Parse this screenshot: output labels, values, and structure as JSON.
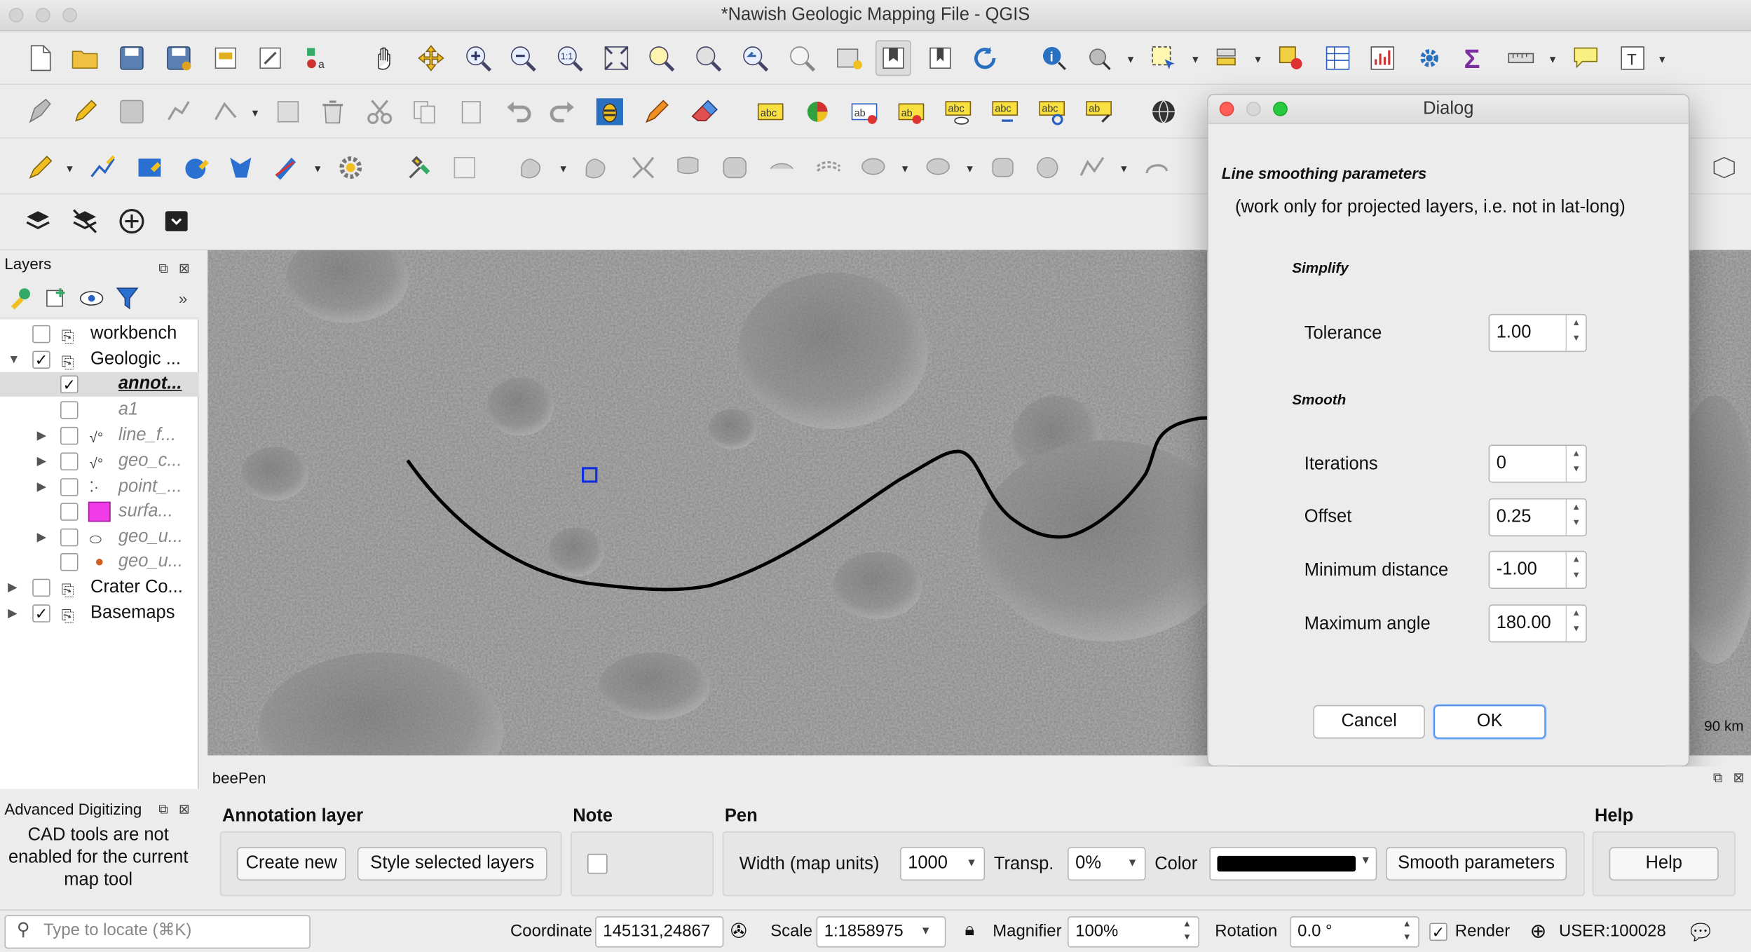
{
  "window": {
    "title": "*Nawish Geologic Mapping File - QGIS"
  },
  "layers_panel": {
    "title": "Layers",
    "items": [
      {
        "label": "workbench",
        "checked": false,
        "italic": false
      },
      {
        "label": "Geologic ...",
        "checked": true,
        "italic": false
      },
      {
        "label": "annot...",
        "checked": true,
        "italic": false
      },
      {
        "label": "a1",
        "checked": false,
        "italic": true
      },
      {
        "label": "line_f...",
        "checked": false,
        "italic": true
      },
      {
        "label": "geo_c...",
        "checked": false,
        "italic": true
      },
      {
        "label": "point_...",
        "checked": false,
        "italic": true
      },
      {
        "label": "surfa...",
        "checked": false,
        "italic": true
      },
      {
        "label": "geo_u...",
        "checked": false,
        "italic": true
      },
      {
        "label": "geo_u...",
        "checked": false,
        "italic": true
      },
      {
        "label": "Crater Co...",
        "checked": false,
        "italic": false
      },
      {
        "label": "Basemaps",
        "checked": true,
        "italic": false
      }
    ]
  },
  "map": {
    "scale_label": "90 km"
  },
  "dialog": {
    "title": "Dialog",
    "heading": "Line smoothing parameters",
    "subheading": "(work only for projected layers, i.e. not in lat-long)",
    "simplify_title": "Simplify",
    "tolerance_label": "Tolerance",
    "tolerance_value": "1.00",
    "smooth_title": "Smooth",
    "iterations_label": "Iterations",
    "iterations_value": "0",
    "offset_label": "Offset",
    "offset_value": "0.25",
    "min_distance_label": "Minimum distance",
    "min_distance_value": "-1.00",
    "max_angle_label": "Maximum angle",
    "max_angle_value": "180.00",
    "cancel_label": "Cancel",
    "ok_label": "OK"
  },
  "advanced_digitizing": {
    "title": "Advanced Digitizing",
    "message": "CAD tools are not enabled for the current map tool"
  },
  "beepen": {
    "title": "beePen",
    "annotation_layer_label": "Annotation layer",
    "create_new_label": "Create new",
    "style_selected_label": "Style selected layers",
    "note_label": "Note",
    "pen_label": "Pen",
    "width_label": "Width (map units)",
    "width_value": "1000",
    "transp_label": "Transp.",
    "transp_value": "0%",
    "color_label": "Color",
    "color_value": "#000000",
    "smooth_params_label": "Smooth parameters",
    "help_group_label": "Help",
    "help_button_label": "Help"
  },
  "statusbar": {
    "locate_placeholder": "Type to locate (⌘K)",
    "coordinate_label": "Coordinate",
    "coordinate_value": "145131,24867",
    "scale_label": "Scale",
    "scale_value": "1:1858975",
    "magnifier_label": "Magnifier",
    "magnifier_value": "100%",
    "rotation_label": "Rotation",
    "rotation_value": "0.0 °",
    "render_label": "Render",
    "crs_label": "USER:100028"
  }
}
